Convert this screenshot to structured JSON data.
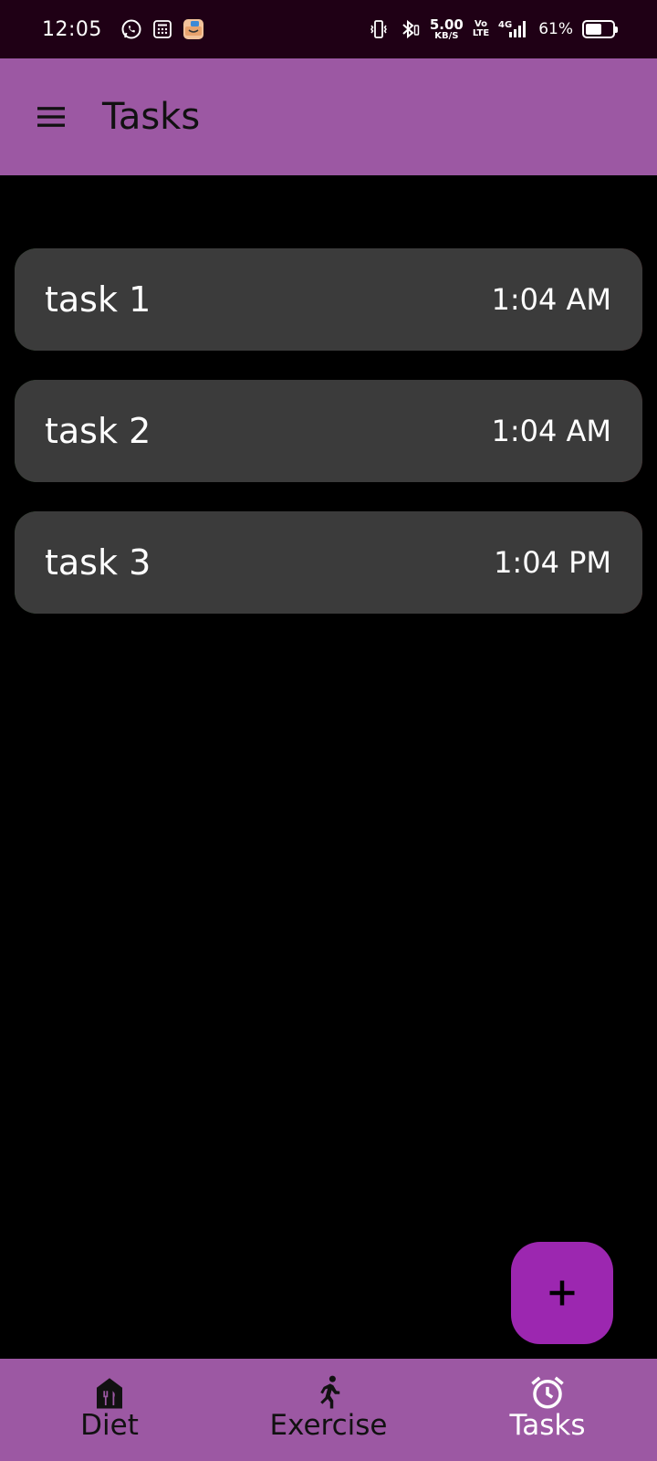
{
  "status_bar": {
    "time": "12:05",
    "net_speed_value": "5.00",
    "net_speed_unit": "KB/S",
    "volte_top": "Vo",
    "volte_bottom": "LTE",
    "network": "4G",
    "battery_percent": "61%",
    "battery_level": 0.61,
    "icons": [
      "whatsapp-icon",
      "calculator-icon",
      "app-icon",
      "vibrate-icon",
      "bluetooth-icon",
      "signal-icon",
      "battery-icon"
    ]
  },
  "app_bar": {
    "title": "Tasks",
    "menu_icon": "hamburger-menu-icon",
    "background": "#9c58a3"
  },
  "tasks": [
    {
      "name": "task 1",
      "time": "1:04 AM"
    },
    {
      "name": "task 2",
      "time": "1:04 AM"
    },
    {
      "name": "task 3",
      "time": "1:04 PM"
    }
  ],
  "fab": {
    "icon": "plus-icon",
    "color": "#9c27b0"
  },
  "bottom_nav": {
    "items": [
      {
        "label": "Diet",
        "icon": "diet-icon"
      },
      {
        "label": "Exercise",
        "icon": "running-icon"
      },
      {
        "label": "Tasks",
        "icon": "alarm-icon"
      }
    ],
    "active": "Tasks"
  },
  "colors": {
    "background": "#000000",
    "card": "#3b3b3b",
    "swipe_left": "#1a5b16",
    "swipe_right": "#6b0a0a",
    "status_bar": "#1f0015"
  }
}
